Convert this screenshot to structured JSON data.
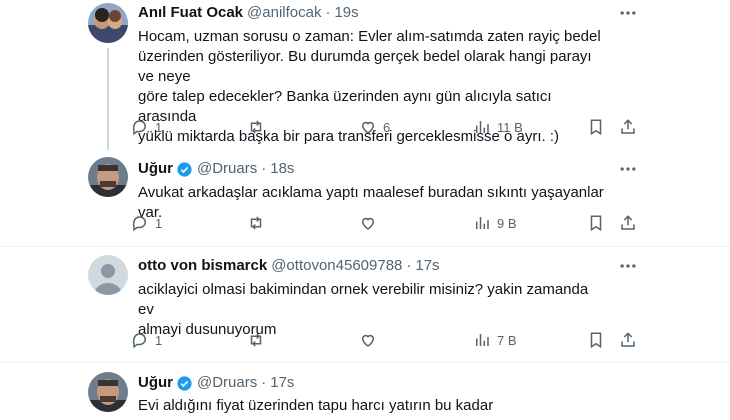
{
  "tweets": [
    {
      "name": "Anıl Fuat Ocak",
      "handle": "@anilfocak",
      "time": "19s",
      "verified": false,
      "lines": [
        "Hocam, uzman sorusu o zaman: Evler alım-satımda zaten rayiç bedel",
        "üzerinden gösteriliyor. Bu durumda gerçek bedel olarak hangi parayı ve neye",
        "göre talep edecekler? Banka üzerinden aynı gün alıcıyla satıcı arasında",
        "yüklü miktarda başka bir para transferi gerceklesmisse o ayrı. :)"
      ],
      "replies": "1",
      "retweets": "",
      "likes": "6",
      "views": "11 B"
    },
    {
      "name": "Uğur",
      "handle": "@Druars",
      "time": "18s",
      "verified": true,
      "lines": [
        "Avukat arkadaşlar acıklama yaptı maalesef buradan sıkıntı yaşayanlar var."
      ],
      "replies": "1",
      "retweets": "",
      "likes": "",
      "views": "9 B"
    },
    {
      "name": "otto von bismarck",
      "handle": "@ottovon45609788",
      "time": "17s",
      "verified": false,
      "lines": [
        "aciklayici olmasi bakimindan ornek verebilir misiniz? yakin zamanda ev",
        "almayi dusunuyorum"
      ],
      "replies": "1",
      "retweets": "",
      "likes": "",
      "views": "7 B"
    },
    {
      "name": "Uğur",
      "handle": "@Druars",
      "time": "17s",
      "verified": true,
      "lines": [
        "Evi aldığını fiyat üzerinden tapu harcı yatırın bu kadar"
      ]
    }
  ],
  "colors": {
    "text": "#0f1419",
    "secondary": "#536471",
    "verified": "#1d9bf0",
    "line": "#cfd9de"
  }
}
